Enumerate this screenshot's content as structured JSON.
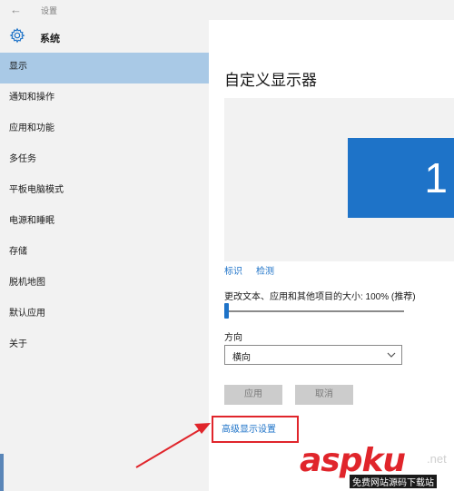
{
  "titlebar": {
    "back_glyph": "←",
    "app_title": "设置"
  },
  "sidebar": {
    "header_label": "系统",
    "items": [
      {
        "label": "显示",
        "selected": true
      },
      {
        "label": "通知和操作"
      },
      {
        "label": "应用和功能"
      },
      {
        "label": "多任务"
      },
      {
        "label": "平板电脑模式"
      },
      {
        "label": "电源和睡眠"
      },
      {
        "label": "存储"
      },
      {
        "label": "脱机地图"
      },
      {
        "label": "默认应用"
      },
      {
        "label": "关于"
      }
    ]
  },
  "main": {
    "title": "自定义显示器",
    "monitor_number": "1",
    "links": {
      "identify": "标识",
      "detect": "检测"
    },
    "scale_label": "更改文本、应用和其他项目的大小: 100% (推荐)",
    "scale_value_percent": 100,
    "orientation_label": "方向",
    "orientation_value": "横向",
    "apply_label": "应用",
    "cancel_label": "取消",
    "advanced_label": "高级显示设置"
  },
  "watermark": {
    "logo": "aspku",
    "net": ".net",
    "sub": "免费网站源码下载站"
  },
  "colors": {
    "accent": "#1e73c8",
    "selected_bg": "#a9c9e6",
    "annotation": "#e0252b"
  },
  "icons": {
    "back": "arrow-left-icon",
    "system": "gear-icon",
    "dropdown": "chevron-down-icon"
  }
}
